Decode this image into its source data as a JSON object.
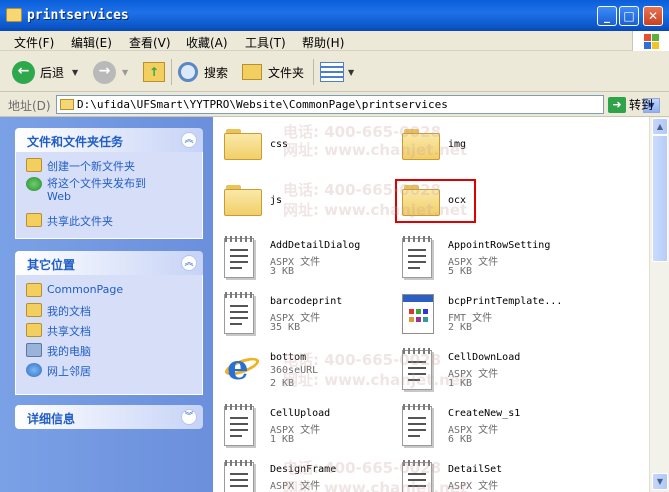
{
  "window": {
    "title": "printservices"
  },
  "menu": [
    "文件(F)",
    "编辑(E)",
    "查看(V)",
    "收藏(A)",
    "工具(T)",
    "帮助(H)"
  ],
  "toolbar": {
    "back": "后退",
    "search": "搜索",
    "folders": "文件夹"
  },
  "address": {
    "label": "地址(D)",
    "value": "D:\\ufida\\UFSmart\\YYTPRO\\Website\\CommonPage\\printservices",
    "go": "转到"
  },
  "tasks": {
    "title": "文件和文件夹任务",
    "items": [
      "创建一个新文件夹",
      "将这个文件夹发布到",
      "Web",
      "共享此文件夹"
    ]
  },
  "places": {
    "title": "其它位置",
    "items": [
      "CommonPage",
      "我的文档",
      "共享文档",
      "我的电脑",
      "网上邻居"
    ]
  },
  "details": {
    "title": "详细信息"
  },
  "files": [
    {
      "name": "css",
      "kind": "folder"
    },
    {
      "name": "img",
      "kind": "folder"
    },
    {
      "name": "js",
      "kind": "folder"
    },
    {
      "name": "ocx",
      "kind": "folder"
    },
    {
      "name": "AddDetailDialog",
      "type": "ASPX 文件",
      "size": "3 KB",
      "kind": "aspx"
    },
    {
      "name": "AppointRowSetting",
      "type": "ASPX 文件",
      "size": "5 KB",
      "kind": "aspx"
    },
    {
      "name": "barcodeprint",
      "type": "ASPX 文件",
      "size": "35 KB",
      "kind": "aspx"
    },
    {
      "name": "bcpPrintTemplate...",
      "type": "FMT 文件",
      "size": "2 KB",
      "kind": "fmt"
    },
    {
      "name": "bottom",
      "type": "360seURL",
      "size": "2 KB",
      "kind": "url"
    },
    {
      "name": "CellDownLoad",
      "type": "ASPX 文件",
      "size": "1 KB",
      "kind": "aspx"
    },
    {
      "name": "CellUpload",
      "type": "ASPX 文件",
      "size": "1 KB",
      "kind": "aspx"
    },
    {
      "name": "CreateNew_s1",
      "type": "ASPX 文件",
      "size": "6 KB",
      "kind": "aspx"
    },
    {
      "name": "DesignFrame",
      "type": "ASPX 文件",
      "size": "",
      "kind": "aspx"
    },
    {
      "name": "DetailSet",
      "type": "ASPX 文件",
      "size": "",
      "kind": "aspx"
    }
  ],
  "watermark": {
    "phone": "电话: 400-665-0028",
    "site": "网址: www.chanjet.net"
  }
}
